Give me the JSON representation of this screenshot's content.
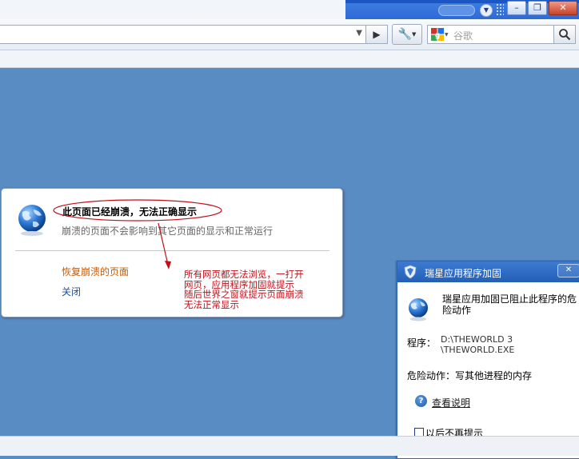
{
  "toolbar": {
    "search_placeholder": "谷歌"
  },
  "crash": {
    "title": "此页面已经崩溃，无法正确显示",
    "description": "崩溃的页面不会影响到其它页面的显示和正常运行",
    "restore_label": "恢复崩溃的页面",
    "close_label": "关闭"
  },
  "annotation": {
    "line1": "所有网页都无法浏览，一打开",
    "line2": "网页，应用程序加固就提示",
    "line3": "随后世界之窗就提示页面崩溃",
    "line4": "无法正常显示",
    "color": "#c0101a"
  },
  "dialog": {
    "title": "瑞星应用程序加固",
    "message": "瑞星应用加固已阻止此程序的危险动作",
    "program_label": "程序：",
    "program_path_1": "D:\\THEWORLD 3",
    "program_path_2": "\\THEWORLD.EXE",
    "action_label": "危险动作：",
    "action_value": "写其他进程的内存",
    "help_label": "查看说明",
    "noremind_label": "以后不再提示"
  },
  "colors": {
    "background": "#5a8cc4",
    "restore_link": "#c85a00",
    "close_link": "#1f4e9c",
    "dialog_title_bar": "#2f6fc8"
  }
}
